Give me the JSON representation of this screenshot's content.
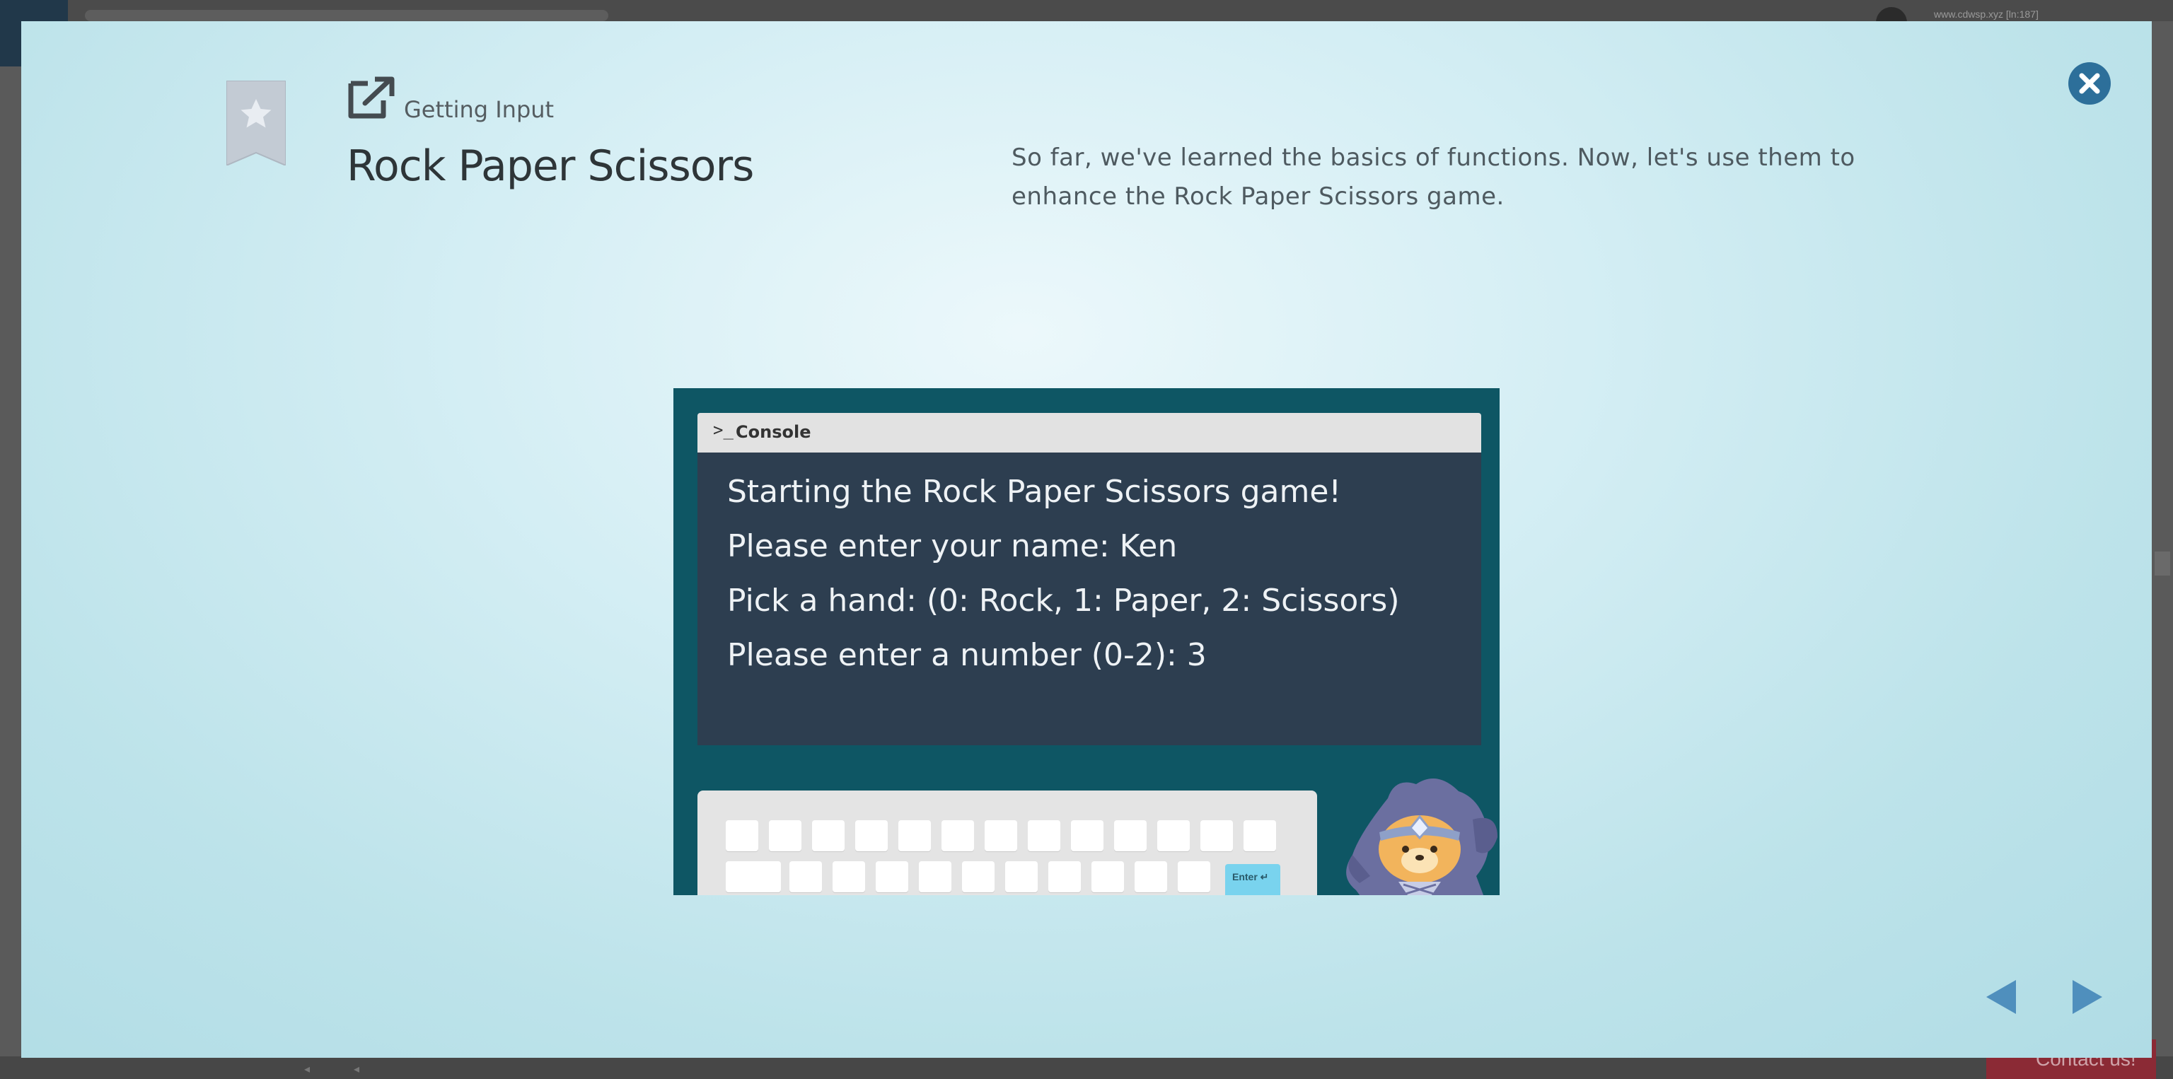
{
  "background": {
    "url_text": "www.cdwsp.xyz [ln:187]",
    "contact_label": "Contact us!"
  },
  "modal": {
    "subtitle": "Getting Input",
    "title": "Rock Paper Scissors",
    "description": "So far, we've learned the basics of functions. Now, let's use them to enhance the Rock Paper Scissors game.",
    "close_icon": "close-circle-icon",
    "bookmark_icon": "star-bookmark-icon",
    "lesson_icon": "external-link-icon"
  },
  "slide": {
    "console_prompt": ">_",
    "console_label": "Console",
    "console_lines": [
      "Starting the Rock Paper Scissors game!",
      "Please enter your name: Ken",
      "Pick a hand: (0: Rock, 1: Paper, 2: Scissors)",
      "Please enter a number (0-2): 3"
    ],
    "enter_key_label": "Enter ↵",
    "mascot": "ninja-mascot"
  },
  "navigation": {
    "prev_icon": "triangle-left-icon",
    "next_icon": "triangle-right-icon"
  },
  "colors": {
    "accent": "#2d6f9a",
    "console_bg": "#2d3e50",
    "slide_bg": "#0e5664",
    "nav": "#4f8fbd"
  }
}
